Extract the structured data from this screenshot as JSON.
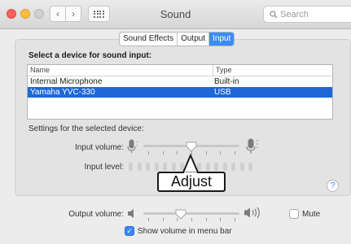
{
  "window": {
    "title": "Sound",
    "search_placeholder": "Search",
    "nav": {
      "back": "‹",
      "forward": "›"
    }
  },
  "tabs": [
    {
      "label": "Sound Effects",
      "active": false
    },
    {
      "label": "Output",
      "active": false
    },
    {
      "label": "Input",
      "active": true
    }
  ],
  "input": {
    "section_title": "Select a device for sound input:",
    "columns": {
      "name": "Name",
      "type": "Type"
    },
    "devices": [
      {
        "name": "Internal Microphone",
        "type": "Built-in",
        "selected": false
      },
      {
        "name": "Yamaha YVC-330",
        "type": "USB",
        "selected": true
      }
    ],
    "settings_label": "Settings for the selected device:",
    "volume_label": "Input volume:",
    "volume_level": 0.5,
    "level_label": "Input level:",
    "level_segments": 15,
    "level_lit": 0
  },
  "callout": {
    "text": "Adjust"
  },
  "help": {
    "label": "?"
  },
  "output": {
    "volume_label": "Output volume:",
    "volume_level": 0.39,
    "mute_label": "Mute",
    "mute_checked": false,
    "show_in_menu_bar_label": "Show volume in menu bar",
    "show_in_menu_bar_checked": true,
    "check_glyph": "✓"
  },
  "colors": {
    "accent": "#3a8cf4",
    "selection": "#1d67d8"
  },
  "icons": [
    "close-icon",
    "minimize-icon",
    "zoom-icon",
    "chevron-left-icon",
    "chevron-right-icon",
    "grid-icon",
    "search-icon",
    "microphone-icon",
    "speaker-icon",
    "speaker-loud-icon",
    "checkmark-icon",
    "help-icon"
  ]
}
